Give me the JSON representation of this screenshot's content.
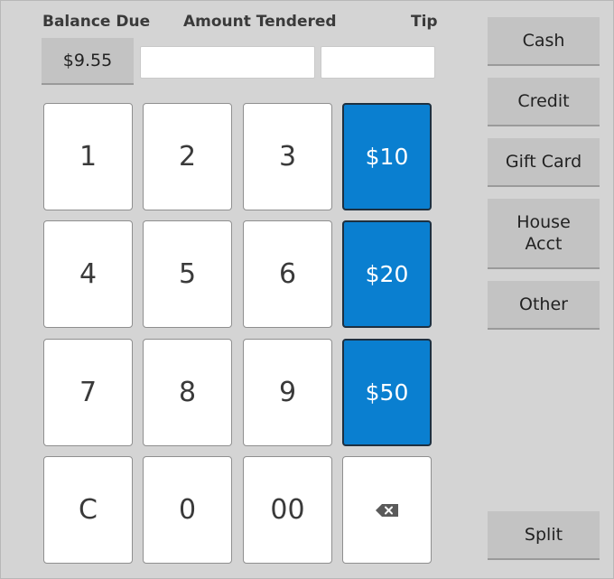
{
  "header": {
    "balance_label": "Balance Due",
    "tendered_label": "Amount Tendered",
    "tip_label": "Tip"
  },
  "balance_due": "$9.55",
  "inputs": {
    "amount_tendered": "",
    "tip": ""
  },
  "keypad": {
    "k1": "1",
    "k2": "2",
    "k3": "3",
    "k4": "4",
    "k5": "5",
    "k6": "6",
    "k7": "7",
    "k8": "8",
    "k9": "9",
    "clear": "C",
    "k0": "0",
    "k00": "00",
    "backspace_icon": "backspace-icon"
  },
  "quick_cash": {
    "ten": "$10",
    "twenty": "$20",
    "fifty": "$50"
  },
  "tender_types": {
    "cash": "Cash",
    "credit": "Credit",
    "gift_card": "Gift Card",
    "house_acct_line1": "House",
    "house_acct_line2": "Acct",
    "other": "Other",
    "split": "Split"
  },
  "colors": {
    "quick_cash_bg": "#0a7fd0",
    "panel_bg": "#d4d4d4",
    "button_bg": "#c3c3c3"
  }
}
